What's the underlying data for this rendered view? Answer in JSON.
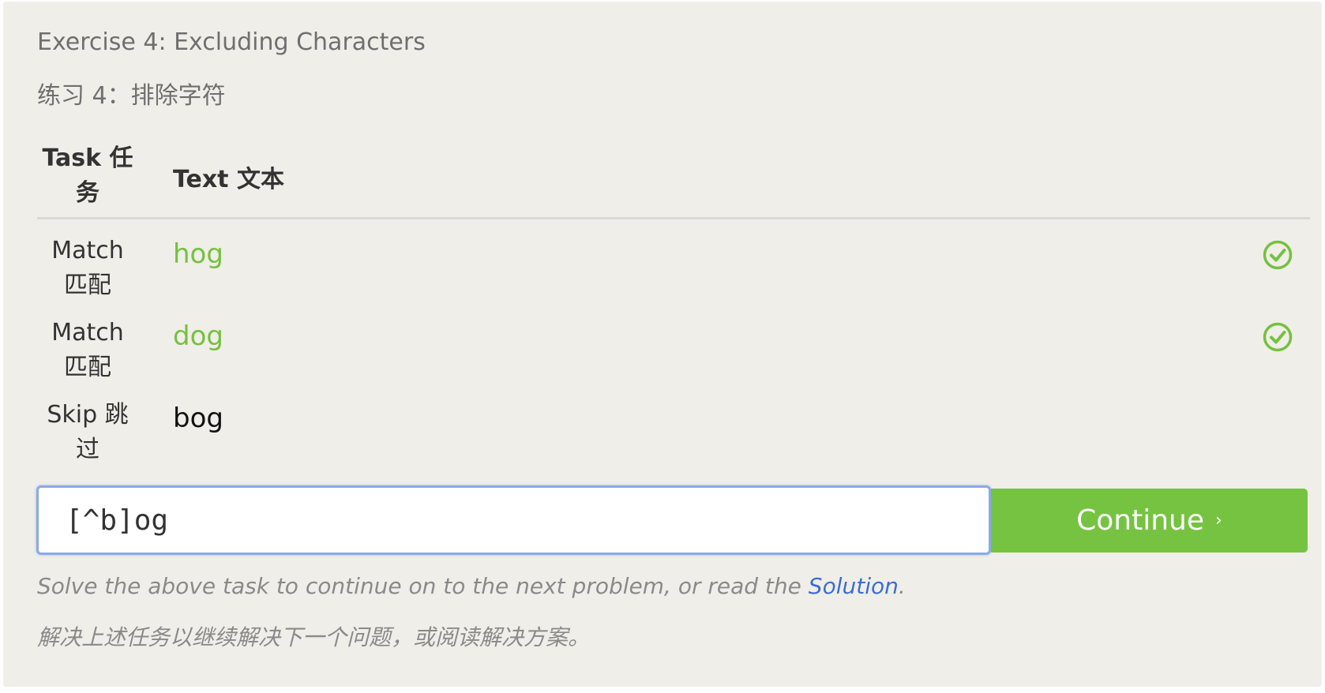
{
  "exercise": {
    "title_en": "Exercise 4: Excluding Characters",
    "title_zh": "练习 4：排除字符"
  },
  "table": {
    "header_task": "Task 任务",
    "header_text": "Text 文本",
    "rows": [
      {
        "task": "Match 匹配",
        "text": "hog",
        "status": "matched",
        "icon": "check-circle-icon"
      },
      {
        "task": "Match 匹配",
        "text": "dog",
        "status": "matched",
        "icon": "check-circle-icon"
      },
      {
        "task": "Skip 跳过",
        "text": "bog",
        "status": "skipped"
      }
    ]
  },
  "input": {
    "value": "[^b]og"
  },
  "continue_button": {
    "label": "Continue",
    "icon": "chevron-right-icon",
    "glyph": "›"
  },
  "hint": {
    "en_before": "Solve the above task to continue on to the next problem, or read the ",
    "solution_link": "Solution",
    "en_after": ".",
    "zh": "解决上述任务以继续解决下一个问题，或阅读解决方案。"
  },
  "colors": {
    "panel_bg": "#f0eee8",
    "match_green": "#74c13f",
    "button_green": "#76c341",
    "link_blue": "#3b6fcf",
    "input_focus_border": "#8aaae6"
  }
}
